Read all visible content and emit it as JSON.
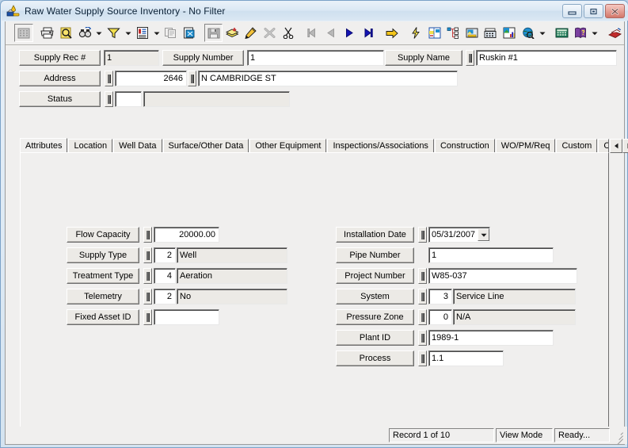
{
  "window": {
    "title": "Raw Water Supply Source Inventory - No Filter",
    "app_icon": "water-supply-icon",
    "buttons": {
      "minimize": "minimize-icon",
      "maximize": "maximize-icon",
      "close": "close-icon"
    }
  },
  "toolbar": {
    "items": [
      {
        "name": "grid-view-icon",
        "state": "disabled"
      },
      {
        "name": "print-icon",
        "state": "enabled"
      },
      {
        "name": "print-preview-icon",
        "state": "enabled"
      },
      {
        "name": "find-icon",
        "state": "enabled"
      },
      {
        "name": "find-dropdown-arrow",
        "state": "enabled"
      },
      {
        "name": "filter-funnel-icon",
        "state": "enabled"
      },
      {
        "name": "filter-dropdown-arrow",
        "state": "enabled"
      },
      {
        "name": "report-icon",
        "state": "enabled"
      },
      {
        "name": "report-dropdown-arrow",
        "state": "enabled"
      },
      {
        "name": "copy-record-icon",
        "state": "disabled"
      },
      {
        "name": "paste-record-icon",
        "state": "enabled"
      },
      {
        "name": "save-icon",
        "state": "disabled"
      },
      {
        "name": "stack-add-icon",
        "state": "enabled"
      },
      {
        "name": "edit-pencil-icon",
        "state": "enabled"
      },
      {
        "name": "delete-x-icon",
        "state": "disabled"
      },
      {
        "name": "cut-scissors-icon",
        "state": "enabled"
      },
      {
        "name": "nav-first-icon",
        "state": "disabled"
      },
      {
        "name": "nav-previous-icon",
        "state": "disabled"
      },
      {
        "name": "nav-next-icon",
        "state": "enabled"
      },
      {
        "name": "nav-last-icon",
        "state": "enabled"
      },
      {
        "name": "go-to-icon",
        "state": "enabled"
      },
      {
        "name": "quick-action-icon",
        "state": "enabled"
      },
      {
        "name": "map-gis-icon",
        "state": "enabled"
      },
      {
        "name": "hierarchy-tree-icon",
        "state": "enabled"
      },
      {
        "name": "attachment-image-icon",
        "state": "enabled"
      },
      {
        "name": "fax-icon",
        "state": "enabled"
      },
      {
        "name": "chart-icon",
        "state": "enabled"
      },
      {
        "name": "globe-web-icon",
        "state": "enabled"
      },
      {
        "name": "globe-dropdown-arrow",
        "state": "enabled"
      },
      {
        "name": "calculator-icon",
        "state": "enabled"
      },
      {
        "name": "help-book-icon",
        "state": "enabled"
      },
      {
        "name": "help-dropdown-arrow",
        "state": "enabled"
      },
      {
        "name": "exit-icon",
        "state": "enabled"
      }
    ]
  },
  "header": {
    "supply_rec": {
      "label": "Supply Rec #",
      "value": "1",
      "readonly": true
    },
    "supply_number": {
      "label": "Supply Number",
      "value": "1"
    },
    "supply_name": {
      "label": "Supply Name",
      "value": "Ruskin #1"
    },
    "address": {
      "label": "Address",
      "number": "2646",
      "street": "N CAMBRIDGE ST"
    },
    "status": {
      "label": "Status",
      "code": "",
      "description": ""
    }
  },
  "tabs": {
    "items": [
      {
        "label": "Attributes",
        "active": true
      },
      {
        "label": "Location",
        "active": false
      },
      {
        "label": "Well Data",
        "active": false
      },
      {
        "label": "Surface/Other Data",
        "active": false
      },
      {
        "label": "Other Equipment",
        "active": false
      },
      {
        "label": "Inspections/Associations",
        "active": false
      },
      {
        "label": "Construction",
        "active": false
      },
      {
        "label": "WO/PM/Req",
        "active": false
      },
      {
        "label": "Custom",
        "active": false
      },
      {
        "label": "Con",
        "active": false
      }
    ],
    "scroll_left_icon": "scroll-left-arrow",
    "scroll_right_icon": "scroll-right-arrow"
  },
  "attributes": {
    "left_column": [
      {
        "label": "Flow Capacity",
        "code": null,
        "value": "20000.00",
        "align": "right"
      },
      {
        "label": "Supply Type",
        "code": "2",
        "value": "Well"
      },
      {
        "label": "Treatment Type",
        "code": "4",
        "value": "Aeration"
      },
      {
        "label": "Telemetry",
        "code": "2",
        "value": "No"
      },
      {
        "label": "Fixed Asset ID",
        "code": null,
        "value": ""
      }
    ],
    "right_column": [
      {
        "label": "Installation Date",
        "code": null,
        "value": "05/31/2007",
        "combo": true
      },
      {
        "label": "Pipe Number",
        "code": null,
        "value": "1",
        "no_selector": true
      },
      {
        "label": "Project Number",
        "code": null,
        "value": "W85-037"
      },
      {
        "label": "System",
        "code": "3",
        "value": "Service Line"
      },
      {
        "label": "Pressure Zone",
        "code": "0",
        "value": "N/A"
      },
      {
        "label": "Plant ID",
        "code": null,
        "value": "1989-1"
      },
      {
        "label": "Process",
        "code": null,
        "value": "1.1"
      }
    ]
  },
  "statusbar": {
    "record": "Record 1 of 10",
    "mode": "View Mode",
    "state": "Ready...",
    "grip_icon": "resize-grip-icon"
  }
}
